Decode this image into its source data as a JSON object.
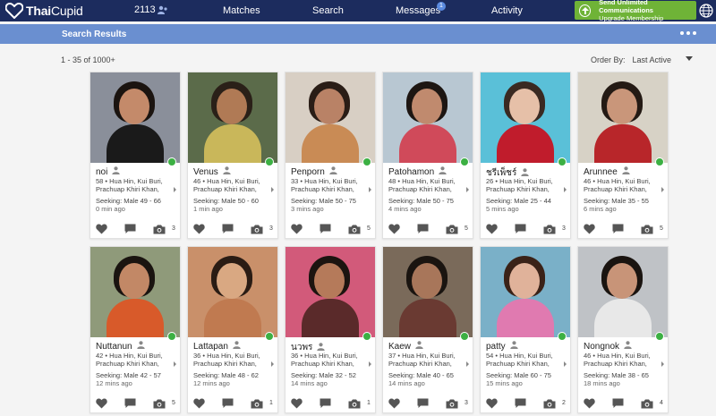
{
  "brand": {
    "name_bold": "Thai",
    "name_rest": "Cupid"
  },
  "nav": {
    "count": "2113",
    "matches": "Matches",
    "search": "Search",
    "messages": "Messages",
    "messages_badge": "1",
    "activity": "Activity"
  },
  "upgrade": {
    "line1": "Send Unlimited Communications",
    "line2": "Upgrade Membership"
  },
  "results": {
    "title": "Search Results",
    "range": "1 - 35 of 1000+",
    "order_label": "Order By:",
    "order_value": "Last Active"
  },
  "colors": {
    "nav_bg": "#1c2c5e",
    "bar_bg": "#6a8fd0",
    "upgrade_bg": "#6fb337",
    "online": "#3cb043"
  },
  "profiles": [
    {
      "name": "noi",
      "age_loc": "58 • Hua Hin, Kui Buri, Prachuap Khiri Khan,",
      "seeking": "Seeking: Male 49 - 66",
      "time": "0 min ago",
      "photos": "3",
      "bg": "#8a8f9a",
      "skin": "#c48a6a",
      "hair": "#1b1410",
      "shirt": "#1a1a1a"
    },
    {
      "name": "Venus",
      "age_loc": "46 • Hua Hin, Kui Buri, Prachuap Khiri Khan,",
      "seeking": "Seeking: Male 50 - 60",
      "time": "1 min ago",
      "photos": "3",
      "bg": "#5b6b4a",
      "skin": "#b07a55",
      "hair": "#2a2018",
      "shirt": "#c9b75a"
    },
    {
      "name": "Penporn",
      "age_loc": "33 • Hua Hin, Kui Buri, Prachuap Khiri Khan,",
      "seeking": "Seeking: Male 50 - 75",
      "time": "3 mins ago",
      "photos": "5",
      "bg": "#d8cfc4",
      "skin": "#b98266",
      "hair": "#2a1d16",
      "shirt": "#c98b55"
    },
    {
      "name": "Patohamon",
      "age_loc": "48 • Hua Hin, Kui Buri, Prachuap Khiri Khan,",
      "seeking": "Seeking: Male 50 - 75",
      "time": "4 mins ago",
      "photos": "5",
      "bg": "#b8c7d2",
      "skin": "#c08a6e",
      "hair": "#1d1612",
      "shirt": "#d04a5a"
    },
    {
      "name": "ชรีเพ็ชร์",
      "age_loc": "26 • Hua Hin, Kui Buri, Prachuap Khiri Khan,",
      "seeking": "Seeking: Male 25 - 44",
      "time": "5 mins ago",
      "photos": "3",
      "bg": "#5ac0d8",
      "skin": "#e6c0a8",
      "hair": "#3a2a22",
      "shirt": "#c01c2c"
    },
    {
      "name": "Arunnee",
      "age_loc": "46 • Hua Hin, Kui Buri, Prachuap Khiri Khan,",
      "seeking": "Seeking: Male 35 - 55",
      "time": "6 mins ago",
      "photos": "5",
      "bg": "#d7d2c6",
      "skin": "#c9967a",
      "hair": "#241a14",
      "shirt": "#b8262a"
    },
    {
      "name": "Nuttanun",
      "age_loc": "42 • Hua Hin, Kui Buri, Prachuap Khiri Khan,",
      "seeking": "Seeking: Male 42 - 57",
      "time": "12 mins ago",
      "photos": "5",
      "bg": "#8f9a7a",
      "skin": "#c28866",
      "hair": "#1a1410",
      "shirt": "#d85a2a"
    },
    {
      "name": "Lattapan",
      "age_loc": "36 • Hua Hin, Kui Buri, Prachuap Khiri Khan,",
      "seeking": "Seeking: Male 48 - 62",
      "time": "12 mins ago",
      "photos": "1",
      "bg": "#c9906a",
      "skin": "#d9a882",
      "hair": "#2a1c14",
      "shirt": "#c07a50"
    },
    {
      "name": "นวพร",
      "age_loc": "36 • Hua Hin, Kui Buri, Prachuap Khiri Khan,",
      "seeking": "Seeking: Male 32 - 52",
      "time": "14 mins ago",
      "photos": "1",
      "bg": "#d25a7a",
      "skin": "#b57a5a",
      "hair": "#1c1410",
      "shirt": "#5a2a2a"
    },
    {
      "name": "Kaew",
      "age_loc": "37 • Hua Hin, Kui Buri, Prachuap Khiri Khan,",
      "seeking": "Seeking: Male 40 - 65",
      "time": "14 mins ago",
      "photos": "3",
      "bg": "#7a6a5a",
      "skin": "#a8765a",
      "hair": "#1a1410",
      "shirt": "#6a3a32"
    },
    {
      "name": "patty",
      "age_loc": "54 • Hua Hin, Kui Buri, Prachuap Khiri Khan,",
      "seeking": "Seeking: Male 60 - 75",
      "time": "15 mins ago",
      "photos": "2",
      "bg": "#7ab0c8",
      "skin": "#e0b29a",
      "hair": "#3a2218",
      "shirt": "#e07ab0"
    },
    {
      "name": "Nongnok",
      "age_loc": "46 • Hua Hin, Kui Buri, Prachuap Khiri Khan,",
      "seeking": "Seeking: Male 38 - 65",
      "time": "18 mins ago",
      "photos": "4",
      "bg": "#bfc2c6",
      "skin": "#c89478",
      "hair": "#1a1410",
      "shirt": "#e8e8e8"
    }
  ]
}
